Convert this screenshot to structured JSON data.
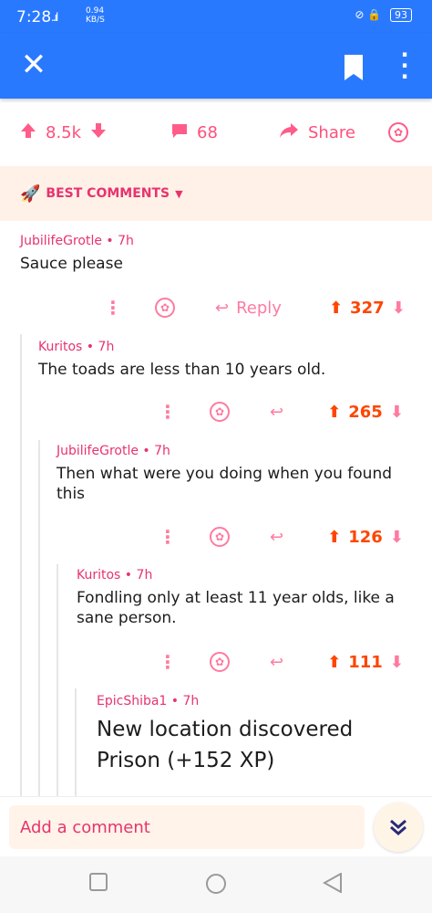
{
  "status": {
    "time": "7:28",
    "signal": "..ıl",
    "net_speed": "0.94",
    "net_unit": "KB/S",
    "right_icons": "⊘ 🔒",
    "battery": "93"
  },
  "post": {
    "upvotes": "8.5k",
    "comments_count": "68",
    "share_label": "Share"
  },
  "sort": {
    "label": "BEST COMMENTS"
  },
  "comments": [
    {
      "author": "JubilifeGrotle",
      "time": "7h",
      "body": "Sauce please",
      "score": "327",
      "reply_label": "Reply"
    },
    {
      "author": "Kuritos",
      "time": "7h",
      "body": "The toads are less than 10 years old.",
      "score": "265"
    },
    {
      "author": "JubilifeGrotle",
      "time": "7h",
      "body": "Then what were you doing when you found this",
      "score": "126"
    },
    {
      "author": "Kuritos",
      "time": "7h",
      "body": "Fondling only at least 11 year olds, like a sane person.",
      "score": "111"
    },
    {
      "author": "EpicShiba1",
      "time": "7h",
      "body": "New location discovered Prison (+152 XP)"
    }
  ],
  "composer": {
    "placeholder": "Add a comment"
  },
  "icons": {
    "close": "close-icon",
    "bookmark": "bookmark-icon",
    "more": "more-vertical-icon",
    "upvote": "arrow-up-icon",
    "downvote": "arrow-down-icon",
    "comment": "comment-icon",
    "share": "share-icon",
    "award": "award-icon",
    "rocket": "rocket-icon",
    "reply": "reply-icon",
    "chevrons": "double-chevron-down-icon"
  },
  "colors": {
    "app_bar": "#2979ff",
    "accent_pink": "#ff5c8a",
    "upvote_orange": "#ff4500",
    "best_bar_bg": "#fff1e8"
  }
}
